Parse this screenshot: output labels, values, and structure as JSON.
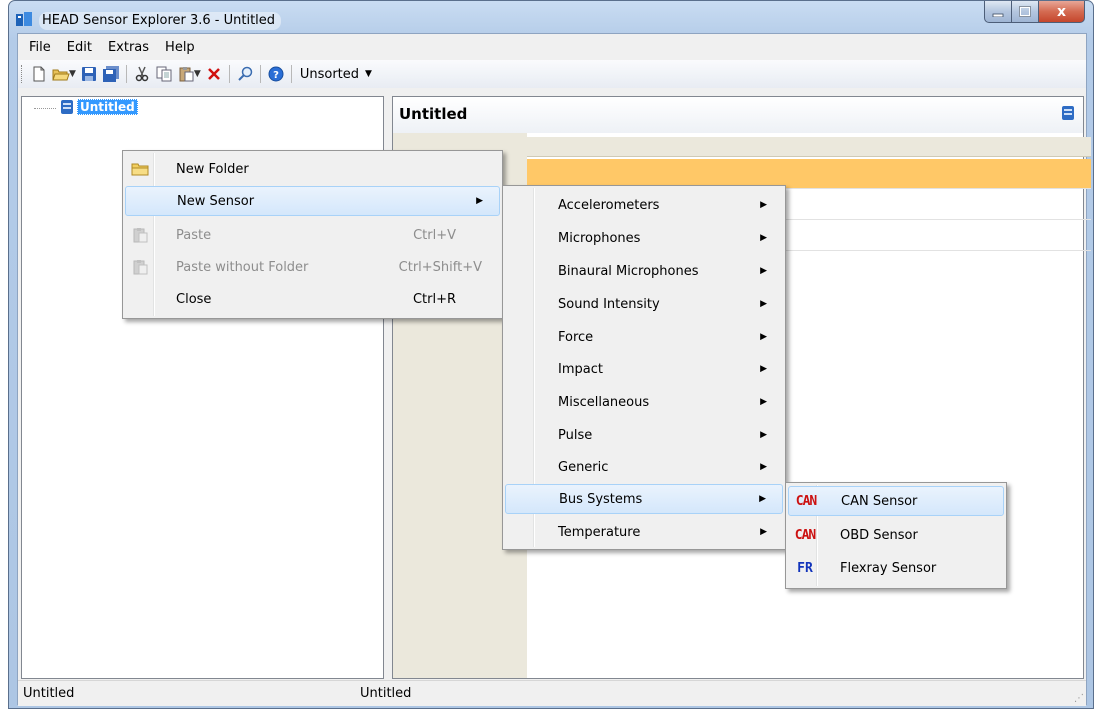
{
  "window": {
    "title": "HEAD Sensor Explorer 3.6 - Untitled",
    "close_glyph": "x"
  },
  "menubar": [
    "File",
    "Edit",
    "Extras",
    "Help"
  ],
  "toolbar": {
    "sort_combo": "Unsorted",
    "icons": [
      "new-icon",
      "open-icon",
      "save-icon",
      "save-all-icon",
      "cut-icon",
      "copy-icon",
      "paste-icon",
      "delete-icon",
      "find-icon",
      "help-icon"
    ]
  },
  "tree": {
    "root_label": "Untitled"
  },
  "detail": {
    "title": "Untitled"
  },
  "status": {
    "left": "Untitled",
    "mid": "Untitled"
  },
  "context_menu": {
    "items": [
      {
        "label": "New Folder",
        "shortcut": "",
        "icon": "folder-icon",
        "disabled": false
      },
      {
        "label": "New Sensor",
        "shortcut": "",
        "icon": "",
        "submenu": true,
        "highlighted": true
      },
      {
        "label": "Paste",
        "shortcut": "Ctrl+V",
        "icon": "paste-icon",
        "disabled": true
      },
      {
        "label": "Paste without Folder",
        "shortcut": "Ctrl+Shift+V",
        "icon": "paste-icon",
        "disabled": true
      },
      {
        "label": "Close",
        "shortcut": "Ctrl+R",
        "icon": "",
        "disabled": false
      }
    ]
  },
  "sensor_menu": {
    "items": [
      "Accelerometers",
      "Microphones",
      "Binaural Microphones",
      "Sound Intensity",
      "Force",
      "Impact",
      "Miscellaneous",
      "Pulse",
      "Generic",
      "Bus Systems",
      "Temperature"
    ],
    "highlighted": "Bus Systems"
  },
  "bus_menu": {
    "items": [
      {
        "label": "CAN Sensor",
        "icon_text": "CAN",
        "highlighted": true
      },
      {
        "label": "OBD Sensor",
        "icon_text": "CAN"
      },
      {
        "label": "Flexray Sensor",
        "icon_text": "FR"
      }
    ]
  },
  "colors": {
    "selection_row": "#ffc867",
    "menu_highlight": "#d4e7fb",
    "tree_selection": "#3399ff",
    "can_icon": "#cc1111",
    "fr_icon": "#1133bb"
  }
}
